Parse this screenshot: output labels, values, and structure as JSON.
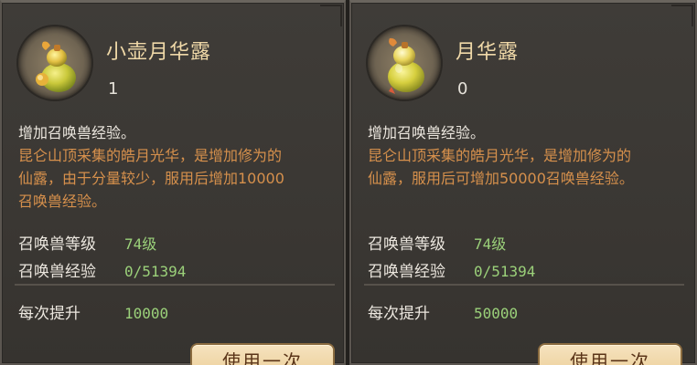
{
  "colors": {
    "panel_bg": "#3d3a36",
    "title": "#f0d9a8",
    "flavor_text": "#d6904c",
    "value_green": "#9bd17a",
    "button_bg": "#efd5a4",
    "button_text": "#5a3418"
  },
  "cards": [
    {
      "icon": "gourd-potion-icon",
      "name": "小壶月华露",
      "count": "1",
      "desc_head": "增加召唤兽经验。",
      "desc_lines": [
        "昆仑山顶采集的皓月光华，是增加修为的",
        "仙露，由于分量较少，服用后增加10000",
        "召唤兽经验。"
      ],
      "stats": [
        {
          "label": "召唤兽等级",
          "value": "74级"
        },
        {
          "label": "召唤兽经验",
          "value": "0/51394"
        }
      ],
      "gain_label": "每次提升",
      "gain_value": "10000",
      "button_label": "使用一次"
    },
    {
      "icon": "gourd-potion-icon",
      "name": "月华露",
      "count": "0",
      "desc_head": "增加召唤兽经验。",
      "desc_lines": [
        "昆仑山顶采集的皓月光华，是增加修为的",
        "仙露，服用后可增加50000召唤兽经验。"
      ],
      "stats": [
        {
          "label": "召唤兽等级",
          "value": "74级"
        },
        {
          "label": "召唤兽经验",
          "value": "0/51394"
        }
      ],
      "gain_label": "每次提升",
      "gain_value": "50000",
      "button_label": "使用一次"
    }
  ]
}
